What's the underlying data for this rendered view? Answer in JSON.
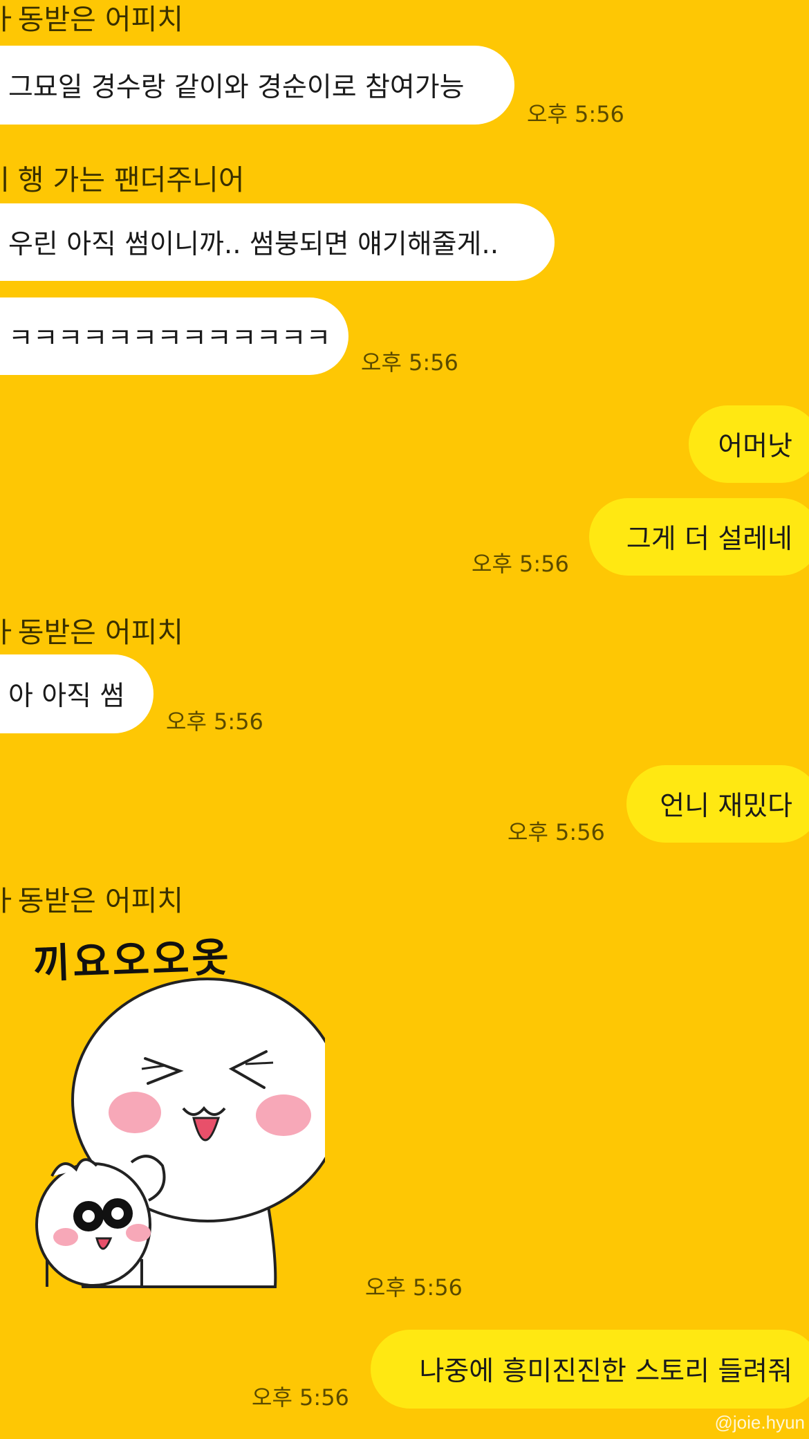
{
  "chat": {
    "messages": [
      {
        "sender": "ㅏ동받은 어피치"
      },
      {
        "text": "그묘일 경수랑 같이와 경순이로 참여가능",
        "time": "오후 5:56"
      },
      {
        "sender": "ㅣ행 가는 팬더주니어"
      },
      {
        "text": "우린 아직 썸이니까.. 썸붕되면 얘기해줄게.."
      },
      {
        "text": "ㅋㅋㅋㅋㅋㅋㅋㅋㅋㅋㅋㅋㅋ",
        "time": "오후 5:56"
      },
      {
        "text": "어머낫"
      },
      {
        "text": "그게 더 설레네",
        "time": "오후 5:56"
      },
      {
        "sender": "ㅏ동받은 어피치"
      },
      {
        "text": "아 아직 썸",
        "time": "오후 5:56"
      },
      {
        "text": "언니 재밌다",
        "time": "오후 5:56"
      },
      {
        "sender": "ㅏ동받은 어피치"
      },
      {
        "sticker_text": "끼요오오옷",
        "time": "오후 5:56"
      },
      {
        "text": "나중에 흥미진진한 스토리 들려줘",
        "time": "오후 5:56"
      }
    ],
    "watermark": "@joie.hyun"
  },
  "colors": {
    "background": "#FEC704",
    "incoming_bubble": "#FFFFFF",
    "outgoing_bubble": "#FFE812",
    "cheeks": "#F7A8B8"
  }
}
